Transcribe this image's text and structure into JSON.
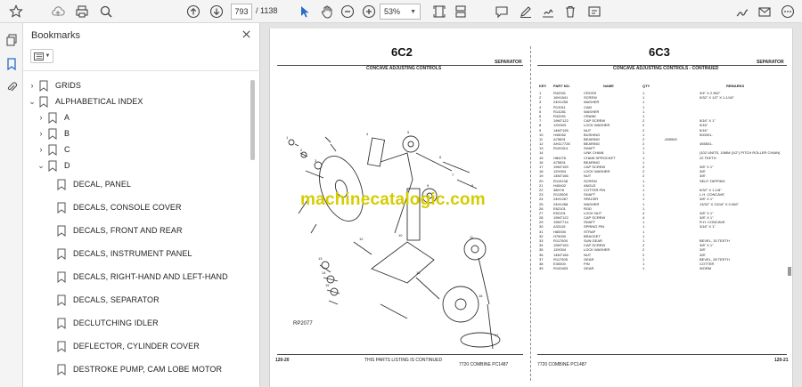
{
  "toolbar": {
    "page_current": "793",
    "page_total": "/ 1138",
    "zoom": "53%",
    "buttons": [
      "star-icon",
      "cloud-upload-icon",
      "print-icon",
      "search-icon",
      "page-up-icon",
      "page-down-icon",
      "cursor-icon",
      "hand-icon",
      "zoom-out-icon",
      "zoom-in-icon",
      "page-fit-icon",
      "scroll-mode-icon",
      "comment-icon",
      "pen-icon",
      "annotate-icon",
      "delete-icon",
      "more-tools-icon",
      "sign-icon",
      "email-icon",
      "more-icon"
    ]
  },
  "rail": {
    "icons": [
      "pages-icon",
      "bookmark-icon",
      "attachment-icon"
    ]
  },
  "bookmarks": {
    "title": "Bookmarks",
    "items": [
      {
        "label": "GRIDS",
        "level": 0,
        "arrow": "›"
      },
      {
        "label": "ALPHABETICAL INDEX",
        "level": 0,
        "arrow": "⌄"
      },
      {
        "label": "A",
        "level": 1,
        "arrow": "›"
      },
      {
        "label": "B",
        "level": 1,
        "arrow": "›"
      },
      {
        "label": "C",
        "level": 1,
        "arrow": "›"
      },
      {
        "label": "D",
        "level": 1,
        "arrow": "⌄"
      },
      {
        "label": "DECAL, PANEL",
        "level": 2,
        "arrow": ""
      },
      {
        "label": "DECALS, CONSOLE COVER",
        "level": 2,
        "arrow": ""
      },
      {
        "label": "DECALS, FRONT AND REAR",
        "level": 2,
        "arrow": ""
      },
      {
        "label": "DECALS, INSTRUMENT PANEL",
        "level": 2,
        "arrow": ""
      },
      {
        "label": "DECALS, RIGHT-HAND AND LEFT-HAND",
        "level": 2,
        "arrow": ""
      },
      {
        "label": "DECALS, SEPARATOR",
        "level": 2,
        "arrow": ""
      },
      {
        "label": "DECLUTCHING IDLER",
        "level": 2,
        "arrow": ""
      },
      {
        "label": "DEFLECTOR, CYLINDER COVER",
        "level": 2,
        "arrow": ""
      },
      {
        "label": "DESTROKE PUMP, CAM LOBE MOTOR",
        "level": 2,
        "arrow": ""
      }
    ]
  },
  "document": {
    "left_title": "6C2",
    "right_title": "6C3",
    "section_left": "SEPARATOR",
    "section_right": "SEPARATOR",
    "left_subtitle": "CONCAVE ADJUSTING CONTROLS",
    "right_subtitle": "CONCAVE ADJUSTING CONTROLS - CONTINUED",
    "ref_code": "RP2077",
    "watermark": "machinecatalogic.com",
    "footer_left_num": "120-20",
    "footer_right_num": "120-21",
    "footer_left_text": "THIS PARTS LISTING IS CONTINUED",
    "footer_center_left": "7720 COMBINE  PC1487",
    "footer_center_right": "7720 COMBINE  PC1487",
    "table_headers": [
      "KEY",
      "PART NO.",
      "NAME",
      "QTY",
      "",
      "REMARKS"
    ],
    "table_rows": [
      [
        "1",
        "R42001",
        "CROSS",
        "1",
        "",
        "3/4\" X 2.362\""
      ],
      [
        "2",
        "16H1841",
        "SCREW",
        "1",
        "",
        "5/32\" X 1/2\" X 1-1/16\""
      ],
      [
        "3",
        "24H1255",
        "WASHER",
        "1",
        "",
        ""
      ],
      [
        "4",
        "R13311",
        "CAM",
        "1",
        "",
        ""
      ],
      [
        "5",
        "R13281",
        "WASHER",
        "1",
        "",
        ""
      ],
      [
        "6",
        "R42001",
        "CRANK",
        "1",
        "",
        ""
      ],
      [
        "7",
        "19M7122",
        "CAP SCREW",
        "2",
        "",
        "5/16\" X 1\""
      ],
      [
        "8",
        "12H303",
        "LOCK WASHER",
        "2",
        "",
        "5/16\""
      ],
      [
        "9",
        "14M7195",
        "NUT",
        "2",
        "",
        "5/16\""
      ],
      [
        "10",
        "H45052",
        "BUSHING",
        "1",
        "",
        "500001-"
      ],
      [
        "11",
        "A75831",
        "BEARING",
        "2",
        "-455500",
        ""
      ],
      [
        "12",
        "AH117728",
        "BEARING",
        "2",
        "",
        "455501-"
      ],
      [
        "13",
        "R100314",
        "SHAFT",
        "1",
        "",
        ""
      ],
      [
        "14",
        "",
        "LINK CHAIN",
        "1",
        "",
        "(102 UNITS, 10MM (1/2\") PITCH ROLLER CHAIN)"
      ],
      [
        "15",
        "H84276",
        "CHAIN SPROCKET",
        "1",
        "",
        "22 TEETH"
      ],
      [
        "16",
        "A75831",
        "BEARING",
        "1",
        "",
        ""
      ],
      [
        "17",
        "19M7159",
        "CAP SCREW",
        "2",
        "",
        "3/8\" X 1\""
      ],
      [
        "18",
        "12H304",
        "LOCK WASHER",
        "2",
        "",
        "3/8\""
      ],
      [
        "19",
        "14M7166",
        "NUT",
        "2",
        "",
        "3/8\""
      ],
      [
        "20",
        "R119138",
        "SCREW",
        "1",
        "",
        "SELF-TAPPING"
      ],
      [
        "21",
        "H45402",
        "ANGLE",
        "1",
        "",
        ""
      ],
      [
        "22",
        "38H78",
        "COTTER PIN",
        "1",
        "",
        "5/32\" X 1-1/8\""
      ],
      [
        "23",
        "R113509",
        "SHAFT",
        "1",
        "",
        "L.H. CONCAVE"
      ],
      [
        "24",
        "24H1267",
        "SPACER",
        "1",
        "",
        "3/8\" X 1\""
      ],
      [
        "25",
        "24H1268",
        "WASHER",
        "1",
        "",
        "13/32\" X 13/16\" X 0.062\""
      ],
      [
        "26",
        "E62101",
        "ROD",
        "1",
        "",
        ""
      ],
      [
        "27",
        "E52101",
        "LOCK NUT",
        "4",
        "",
        "3/8\" X 1\""
      ],
      [
        "28",
        "19M7122",
        "CAP SCREW",
        "4",
        "",
        "3/8\" X 1\""
      ],
      [
        "29",
        "19M7714",
        "SHAFT",
        "1",
        "",
        "R.H. CONCAVE"
      ],
      [
        "30",
        "A33115",
        "SPRING PIN",
        "1",
        "",
        "3/16\" X 1\""
      ],
      [
        "31",
        "H80000",
        "STRAP",
        "1",
        "",
        ""
      ],
      [
        "32",
        "H75000",
        "BRACKET",
        "1",
        "",
        ""
      ],
      [
        "33",
        "R117500",
        "SUN GEAR",
        "1",
        "",
        "BEVEL, 15 TEETH"
      ],
      [
        "34",
        "19M7153",
        "CAP SCREW",
        "2",
        "",
        "3/8\" X 1\""
      ],
      [
        "35",
        "12H304",
        "LOCK WASHER",
        "2",
        "",
        "3/8\""
      ],
      [
        "36",
        "14M7166",
        "NUT",
        "2",
        "",
        "3/8\""
      ],
      [
        "37",
        "R117505",
        "GEAR",
        "1",
        "",
        "BEVEL, 28 TEETH"
      ],
      [
        "38",
        "E30000",
        "PIN",
        "1",
        "",
        "COTTER"
      ],
      [
        "39",
        "R100403",
        "GEAR",
        "1",
        "",
        "WORM"
      ]
    ]
  },
  "colors": {
    "watermark": "#d6cc00",
    "accent": "#2a6cc4"
  }
}
